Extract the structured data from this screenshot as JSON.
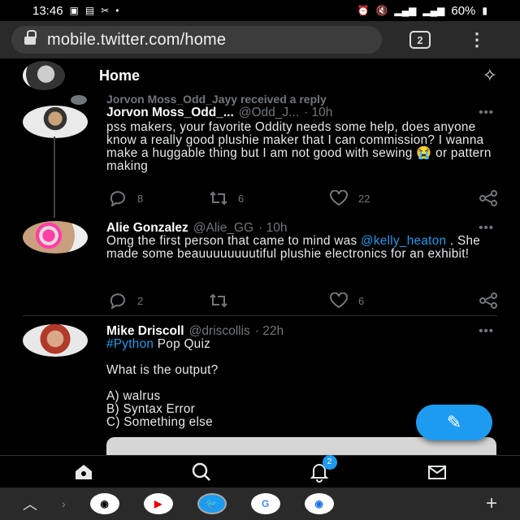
{
  "status_bar": {
    "time": "13:46",
    "battery": "60%"
  },
  "browser": {
    "url": "mobile.twitter.com/home",
    "tab_count": "2"
  },
  "header": {
    "title": "Home"
  },
  "tweets": [
    {
      "context": "Jorvon Moss_Odd_Jayy received a reply",
      "name": "Jorvon Moss_Odd_...",
      "handle": "@Odd_J...",
      "time": "· 10h",
      "text": "pss makers, your favorite Oddity needs some help, does anyone know a really good plushie maker that I can commission? I wanna make a huggable thing but I am not good with sewing 😭 or pattern making",
      "replies": "8",
      "retweets": "6",
      "likes": "22"
    },
    {
      "name": "Alie Gonzalez",
      "handle": "@Alie_GG",
      "time": "· 10h",
      "text_before": "Omg the first person that came to mind was ",
      "mention": "@kelly_heaton",
      "text_after": " . She made some beauuuuuuuutiful plushie electronics for an exhibit!",
      "replies": "2",
      "retweets": "",
      "likes": "6"
    },
    {
      "name": "Mike Driscoll",
      "handle": "@driscollis",
      "time": "· 22h",
      "hashtag": "#Python",
      "line1_rest": " Pop Quiz",
      "line2": "What is the output?",
      "opt_a": "A) walrus",
      "opt_b": "B) Syntax Error",
      "opt_c": "C) Something else"
    }
  ],
  "nav": {
    "notifications_badge": "2"
  },
  "colors": {
    "accent": "#1d9bf0",
    "background": "#000000",
    "muted": "#71767b"
  }
}
